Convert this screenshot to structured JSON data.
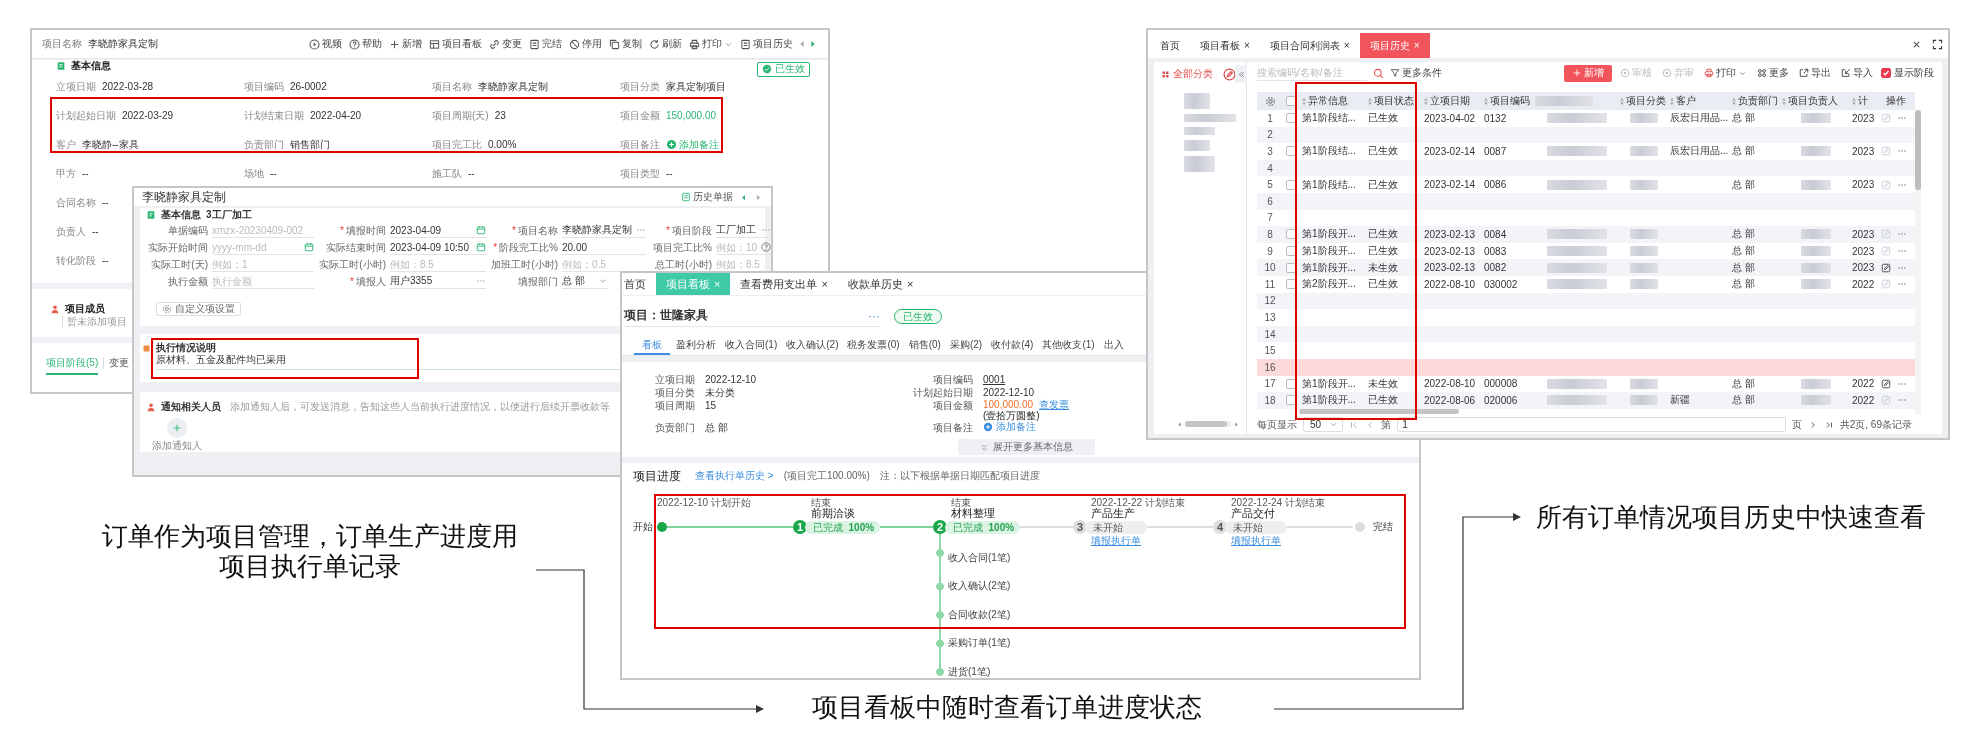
{
  "project_detail": {
    "title_label": "项目名称",
    "title": "李晓静家具定制",
    "toolbar": [
      {
        "label": "视频",
        "kind": "video"
      },
      {
        "label": "帮助",
        "kind": "help"
      },
      {
        "label": "新增",
        "kind": "add"
      },
      {
        "label": "项目看板",
        "kind": "board"
      },
      {
        "label": "变更",
        "kind": "change"
      },
      {
        "label": "完结",
        "kind": "finish"
      },
      {
        "label": "停用",
        "kind": "disable"
      },
      {
        "label": "复制",
        "kind": "copy"
      },
      {
        "label": "刷新",
        "kind": "refresh"
      },
      {
        "label": "打印",
        "kind": "print"
      },
      {
        "label": "项目历史",
        "kind": "history"
      }
    ],
    "section": "基本信息",
    "status": "已生效",
    "rows": [
      [
        {
          "label": "立项日期",
          "value": "2022-03-28",
          "kind": "text"
        },
        {
          "label": "项目编码",
          "value": "26-0002",
          "kind": "text"
        },
        {
          "label": "项目名称",
          "value": "李晓静家具定制",
          "kind": "text"
        },
        {
          "label": "项目分类",
          "value": "家具定制项目",
          "kind": "text"
        }
      ],
      [
        {
          "label": "计划起始日期",
          "value": "2022-03-29",
          "kind": "text"
        },
        {
          "label": "计划结束日期",
          "value": "2022-04-20",
          "kind": "text"
        },
        {
          "label": "项目周期(天)",
          "value": "23",
          "kind": "text"
        },
        {
          "label": "项目金额",
          "value": "150,000.00",
          "kind": "amount"
        }
      ],
      [
        {
          "label": "客户",
          "value": "李晓静--家具",
          "kind": "text"
        },
        {
          "label": "负责部门",
          "value": "销售部门",
          "kind": "text"
        },
        {
          "label": "项目完工比",
          "value": "0.00%",
          "kind": "text"
        },
        {
          "label": "项目备注",
          "value": "添加备注",
          "kind": "link"
        }
      ],
      [
        {
          "label": "甲方",
          "value": "--",
          "kind": "text"
        },
        {
          "label": "场地",
          "value": "--",
          "kind": "text"
        },
        {
          "label": "施工队",
          "value": "--",
          "kind": "text"
        },
        {
          "label": "项目类型",
          "value": "--",
          "kind": "text"
        }
      ],
      [
        {
          "label": "合同名称",
          "value": "--",
          "kind": "text"
        }
      ],
      [
        {
          "label": "负责人",
          "value": "--",
          "kind": "text"
        }
      ],
      [
        {
          "label": "转化阶段",
          "value": "--",
          "kind": "text"
        }
      ]
    ],
    "members": {
      "title": "项目成员",
      "empty_text": "暂未添加项目"
    },
    "tabs": [
      {
        "label": "项目阶段(5)",
        "selected": true
      },
      {
        "label": "变更",
        "selected": false
      }
    ]
  },
  "execution_form": {
    "title": "李晓静家具定制",
    "history_button": "历史单据",
    "section": "基本信息",
    "stage": "3工厂加工",
    "rows": [
      [
        {
          "label": "单据编码",
          "placeholder": "xmzx-20230409-002",
          "kind": "text"
        },
        {
          "label": "填报时间",
          "value": "2023-04-09",
          "kind": "date",
          "mark": "*"
        },
        {
          "label": "项目名称",
          "value": "李晓静家具定制",
          "kind": "picker",
          "mark": "*"
        },
        {
          "label": "项目阶段",
          "value": "工厂加工",
          "kind": "picker",
          "mark": "*"
        }
      ],
      [
        {
          "label": "实际开始时间",
          "placeholder": "yyyy-mm-dd",
          "kind": "date"
        },
        {
          "label": "实际结束时间",
          "value": "2023-04-09 10:50",
          "kind": "date"
        },
        {
          "label": "阶段完工比%",
          "value": "20.00",
          "kind": "text",
          "mark": "*"
        },
        {
          "label": "项目完工比%",
          "placeholder": "例如：10",
          "kind": "help"
        }
      ],
      [
        {
          "label": "实际工时(天)",
          "placeholder": "例如：1",
          "kind": "text"
        },
        {
          "label": "实际工时(小时)",
          "placeholder": "例如：8.5",
          "kind": "text"
        },
        {
          "label": "加班工时(小时)",
          "placeholder": "例如：0.5",
          "kind": "text"
        },
        {
          "label": "总工时(小时)",
          "placeholder": "例如：8.5",
          "kind": "text"
        }
      ],
      [
        {
          "label": "执行金额",
          "placeholder": "执行金额",
          "kind": "text"
        },
        {
          "label": "填报人",
          "value": "用户3355",
          "kind": "picker",
          "mark": "*"
        },
        {
          "label": "填报部门",
          "value": "总 部",
          "kind": "select"
        }
      ]
    ],
    "settings_button": "自定义项设置",
    "notes": {
      "title": "执行情况说明",
      "text": "原材料、五金及配件均已采用"
    },
    "notify": {
      "title": "通知相关人员",
      "hint": "添加通知人后，可发送消息，告知这些人当前执行进度情况，以便进行后续开票收款等",
      "add_label": "添加通知人"
    }
  },
  "project_board": {
    "tabs": [
      {
        "label": "首页",
        "selected": false
      },
      {
        "label": "项目看板",
        "close": "×",
        "selected": true
      },
      {
        "label": "查看费用支出单",
        "close": "×",
        "selected": false
      },
      {
        "label": "收款单历史",
        "close": "×",
        "selected": false
      }
    ],
    "project_label": "项目：",
    "project_name": "世隆家具",
    "more": "···",
    "status": "已生效",
    "subtabs": [
      {
        "label": "看板",
        "selected": true
      },
      {
        "label": "盈利分析",
        "selected": false
      },
      {
        "label": "收入合同(1)",
        "selected": false
      },
      {
        "label": "收入确认(2)",
        "selected": false
      },
      {
        "label": "税务发票(0)",
        "selected": false
      },
      {
        "label": "销售(0)",
        "selected": false
      },
      {
        "label": "采购(2)",
        "selected": false
      },
      {
        "label": "收付款(4)",
        "selected": false
      },
      {
        "label": "其他收支(1)",
        "selected": false
      },
      {
        "label": "出入",
        "selected": false
      }
    ],
    "info_left": [
      {
        "label": "立项日期",
        "value": "2022-12-10"
      },
      {
        "label": "项目分类",
        "value": "未分类"
      },
      {
        "label": "项目周期",
        "value": "15"
      },
      {
        "label": "负责部门",
        "value": "总 部"
      }
    ],
    "info_right": [
      {
        "label": "项目编码",
        "value": "0001",
        "kind": "code"
      },
      {
        "label": "计划起始日期",
        "value": "2022-12-10",
        "kind": "text"
      },
      {
        "label": "项目金额",
        "value": "100,000.00",
        "kind": "amount",
        "link": "查发票",
        "note": "(壹拾万圆整)"
      },
      {
        "label": "项目备注",
        "value": "添加备注",
        "kind": "add"
      }
    ],
    "expand": "展开更多基本信息",
    "progress": {
      "title": "项目进度",
      "history_link": "查看执行单历史 >",
      "completion": "(项目完工100.00%)",
      "note": "注：以下根据单据日期匹配项目进度",
      "timeline": {
        "start": {
          "label": "开始",
          "caption": "2022-12-10 计划开始",
          "done": true
        },
        "stages": [
          {
            "number": "1",
            "caption": "结束",
            "name": "前期洽谈",
            "status": "已完成",
            "percent": "100%",
            "done": true
          },
          {
            "number": "2",
            "caption": "结束",
            "name": "材料整理",
            "status": "已完成",
            "percent": "100%",
            "done": true,
            "items": [
              "收入合同(1笔)",
              "收入确认(2笔)",
              "合同收款(2笔)",
              "采购订单(1笔)",
              "进货(1笔)"
            ]
          },
          {
            "number": "3",
            "caption": "2022-12-22 计划结束",
            "name": "产品生产",
            "status": "未开始",
            "done": false,
            "link": "填报执行单"
          },
          {
            "number": "4",
            "caption": "2022-12-24 计划结束",
            "name": "产品交付",
            "status": "未开始",
            "done": false,
            "link": "填报执行单"
          }
        ],
        "end": {
          "label": "完结",
          "done": false
        }
      }
    }
  },
  "project_history": {
    "tabs": [
      {
        "label": "首页",
        "selected": false
      },
      {
        "label": "项目看板",
        "close": "×",
        "selected": false
      },
      {
        "label": "项目合同利润表",
        "close": "×",
        "selected": false
      },
      {
        "label": "项目历史",
        "close": "×",
        "selected": true
      }
    ],
    "sidebar_title": "全部分类",
    "search_placeholder": "搜索编码/名称/备注",
    "filter_button": "更多条件",
    "actions": [
      {
        "label": "新增",
        "kind": "primary",
        "disabled": false
      },
      {
        "label": "审核",
        "kind": "approve",
        "disabled": true
      },
      {
        "label": "弃审",
        "kind": "unapprove",
        "disabled": true
      },
      {
        "label": "打印",
        "kind": "print",
        "disabled": false
      },
      {
        "label": "更多",
        "kind": "more",
        "disabled": false
      },
      {
        "label": "导出",
        "kind": "export",
        "disabled": false
      },
      {
        "label": "导入",
        "kind": "import",
        "disabled": false
      }
    ],
    "show_stages": {
      "label": "显示阶段",
      "checked": true
    },
    "columns": [
      {
        "kind": "settings"
      },
      {
        "kind": "checkbox",
        "checked": false
      },
      {
        "kind": "sortable",
        "label": "异常信息"
      },
      {
        "kind": "sortable",
        "label": "项目状态"
      },
      {
        "kind": "sortable",
        "label": "立项日期"
      },
      {
        "kind": "sortable",
        "label": "项目编码"
      },
      {
        "kind": "redacted"
      },
      {
        "kind": "sortable",
        "label": "项目分类"
      },
      {
        "kind": "sortable",
        "label": "客户"
      },
      {
        "kind": "sortable",
        "label": "负责部门"
      },
      {
        "kind": "sortable",
        "label": "项目负责人"
      },
      {
        "kind": "sortable",
        "label": "计"
      },
      {
        "kind": "plain",
        "label": "操作"
      }
    ],
    "rows": [
      {
        "number": "1",
        "kind": "data",
        "selected": false,
        "checked": false,
        "info": "第1阶段结...",
        "status": "已生效",
        "date": "2023-04-02",
        "code": "0132",
        "customer": "辰宏日用品...",
        "department": "总 部",
        "plan": "2023",
        "redacted": true,
        "edit_enabled": false
      },
      {
        "number": "2",
        "kind": "empty",
        "selected": false
      },
      {
        "number": "3",
        "kind": "data",
        "selected": false,
        "checked": false,
        "info": "第1阶段结...",
        "status": "已生效",
        "date": "2023-02-14",
        "code": "0087",
        "customer": "辰宏日用品...",
        "department": "总 部",
        "plan": "2023",
        "redacted": true,
        "edit_enabled": false
      },
      {
        "number": "4",
        "kind": "empty",
        "selected": false
      },
      {
        "number": "5",
        "kind": "data",
        "selected": false,
        "checked": false,
        "info": "第1阶段结...",
        "status": "已生效",
        "date": "2023-02-14",
        "code": "0086",
        "department": "总 部",
        "plan": "2023",
        "redacted": true,
        "edit_enabled": false
      },
      {
        "number": "6",
        "kind": "empty",
        "selected": false
      },
      {
        "number": "7",
        "kind": "empty",
        "selected": false
      },
      {
        "number": "8",
        "kind": "data",
        "selected": false,
        "checked": false,
        "info": "第1阶段开...",
        "status": "已生效",
        "date": "2023-02-13",
        "code": "0084",
        "department": "总 部",
        "plan": "2023",
        "redacted": true,
        "edit_enabled": false
      },
      {
        "number": "9",
        "kind": "data",
        "selected": false,
        "checked": false,
        "info": "第1阶段开...",
        "status": "已生效",
        "date": "2023-02-13",
        "code": "0083",
        "department": "总 部",
        "plan": "2023",
        "redacted": true,
        "edit_enabled": false
      },
      {
        "number": "10",
        "kind": "data",
        "selected": false,
        "checked": false,
        "info": "第1阶段开...",
        "status": "未生效",
        "date": "2023-02-13",
        "code": "0082",
        "department": "总 部",
        "plan": "2023",
        "redacted": true,
        "edit_enabled": true
      },
      {
        "number": "11",
        "kind": "data",
        "selected": false,
        "checked": false,
        "info": "第2阶段开...",
        "status": "已生效",
        "date": "2022-08-10",
        "code": "030002",
        "department": "总 部",
        "plan": "2022",
        "redacted": true,
        "edit_enabled": false
      },
      {
        "number": "12",
        "kind": "empty",
        "selected": false
      },
      {
        "number": "13",
        "kind": "empty",
        "selected": false
      },
      {
        "number": "14",
        "kind": "empty",
        "selected": false
      },
      {
        "number": "15",
        "kind": "empty",
        "selected": false
      },
      {
        "number": "16",
        "kind": "empty",
        "selected": true
      },
      {
        "number": "17",
        "kind": "data",
        "selected": false,
        "checked": false,
        "info": "第1阶段开...",
        "status": "未生效",
        "date": "2022-08-10",
        "code": "000008",
        "department": "总 部",
        "plan": "2022",
        "redacted": true,
        "edit_enabled": true
      },
      {
        "number": "18",
        "kind": "data",
        "selected": false,
        "checked": false,
        "info": "第1阶段开...",
        "status": "已生效",
        "date": "2022-08-06",
        "code": "020006",
        "customer": "新疆",
        "department": "总 部",
        "plan": "2022",
        "redacted": true,
        "edit_enabled": false
      }
    ],
    "pagination": {
      "page_size_label": "每页显示",
      "page_size": "50",
      "page_label": "第",
      "page": "1",
      "page_suffix": "页",
      "summary": "共2页, 69条记录"
    }
  },
  "captions": [
    {
      "text": "订单作为项目管理，订单生产进度用"
    },
    {
      "text": "项目执行单记录"
    },
    {
      "text": "项目看板中随时查看订单进度状态"
    },
    {
      "text": "所有订单情况项目历史中快速查看"
    }
  ]
}
